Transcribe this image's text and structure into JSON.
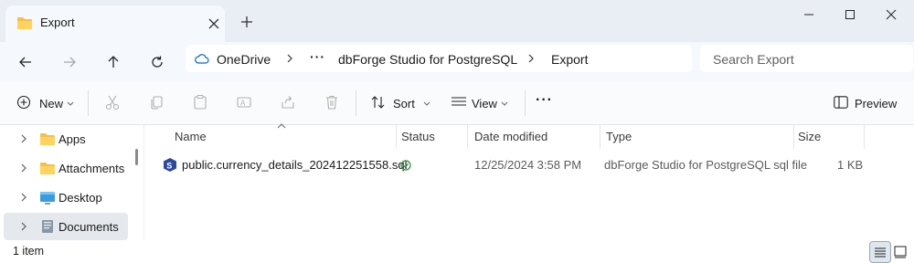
{
  "window": {
    "tab_title": "Export",
    "minimize_icon": "minimize-icon",
    "maximize_icon": "maximize-icon",
    "close_icon": "close-icon"
  },
  "nav": {
    "breadcrumb": [
      "OneDrive",
      "dbForge Studio for PostgreSQL",
      "Export"
    ],
    "overflow": "···",
    "search_placeholder": "Search Export"
  },
  "toolbar": {
    "new_label": "New",
    "sort_label": "Sort",
    "view_label": "View",
    "more_label": "···",
    "preview_label": "Preview"
  },
  "sidebar": {
    "items": [
      {
        "label": "Apps",
        "icon": "folder-icon"
      },
      {
        "label": "Attachments",
        "icon": "folder-icon"
      },
      {
        "label": "Desktop",
        "icon": "desktop-icon"
      },
      {
        "label": "Documents",
        "icon": "documents-icon",
        "selected": true
      }
    ]
  },
  "columns": [
    "Name",
    "Status",
    "Date modified",
    "Type",
    "Size"
  ],
  "files": [
    {
      "name": "public.currency_details_202412251558.sql",
      "status": "synced-check-icon",
      "date_modified": "12/25/2024 3:58 PM",
      "type": "dbForge Studio for PostgreSQL sql file",
      "size": "1 KB"
    }
  ],
  "status_bar": {
    "item_count": "1 item"
  },
  "colors": {
    "accent": "#0067c0",
    "folder": "#f3c04a",
    "sync_ok": "#2e8b3e",
    "selection": "#e5e8ec"
  }
}
